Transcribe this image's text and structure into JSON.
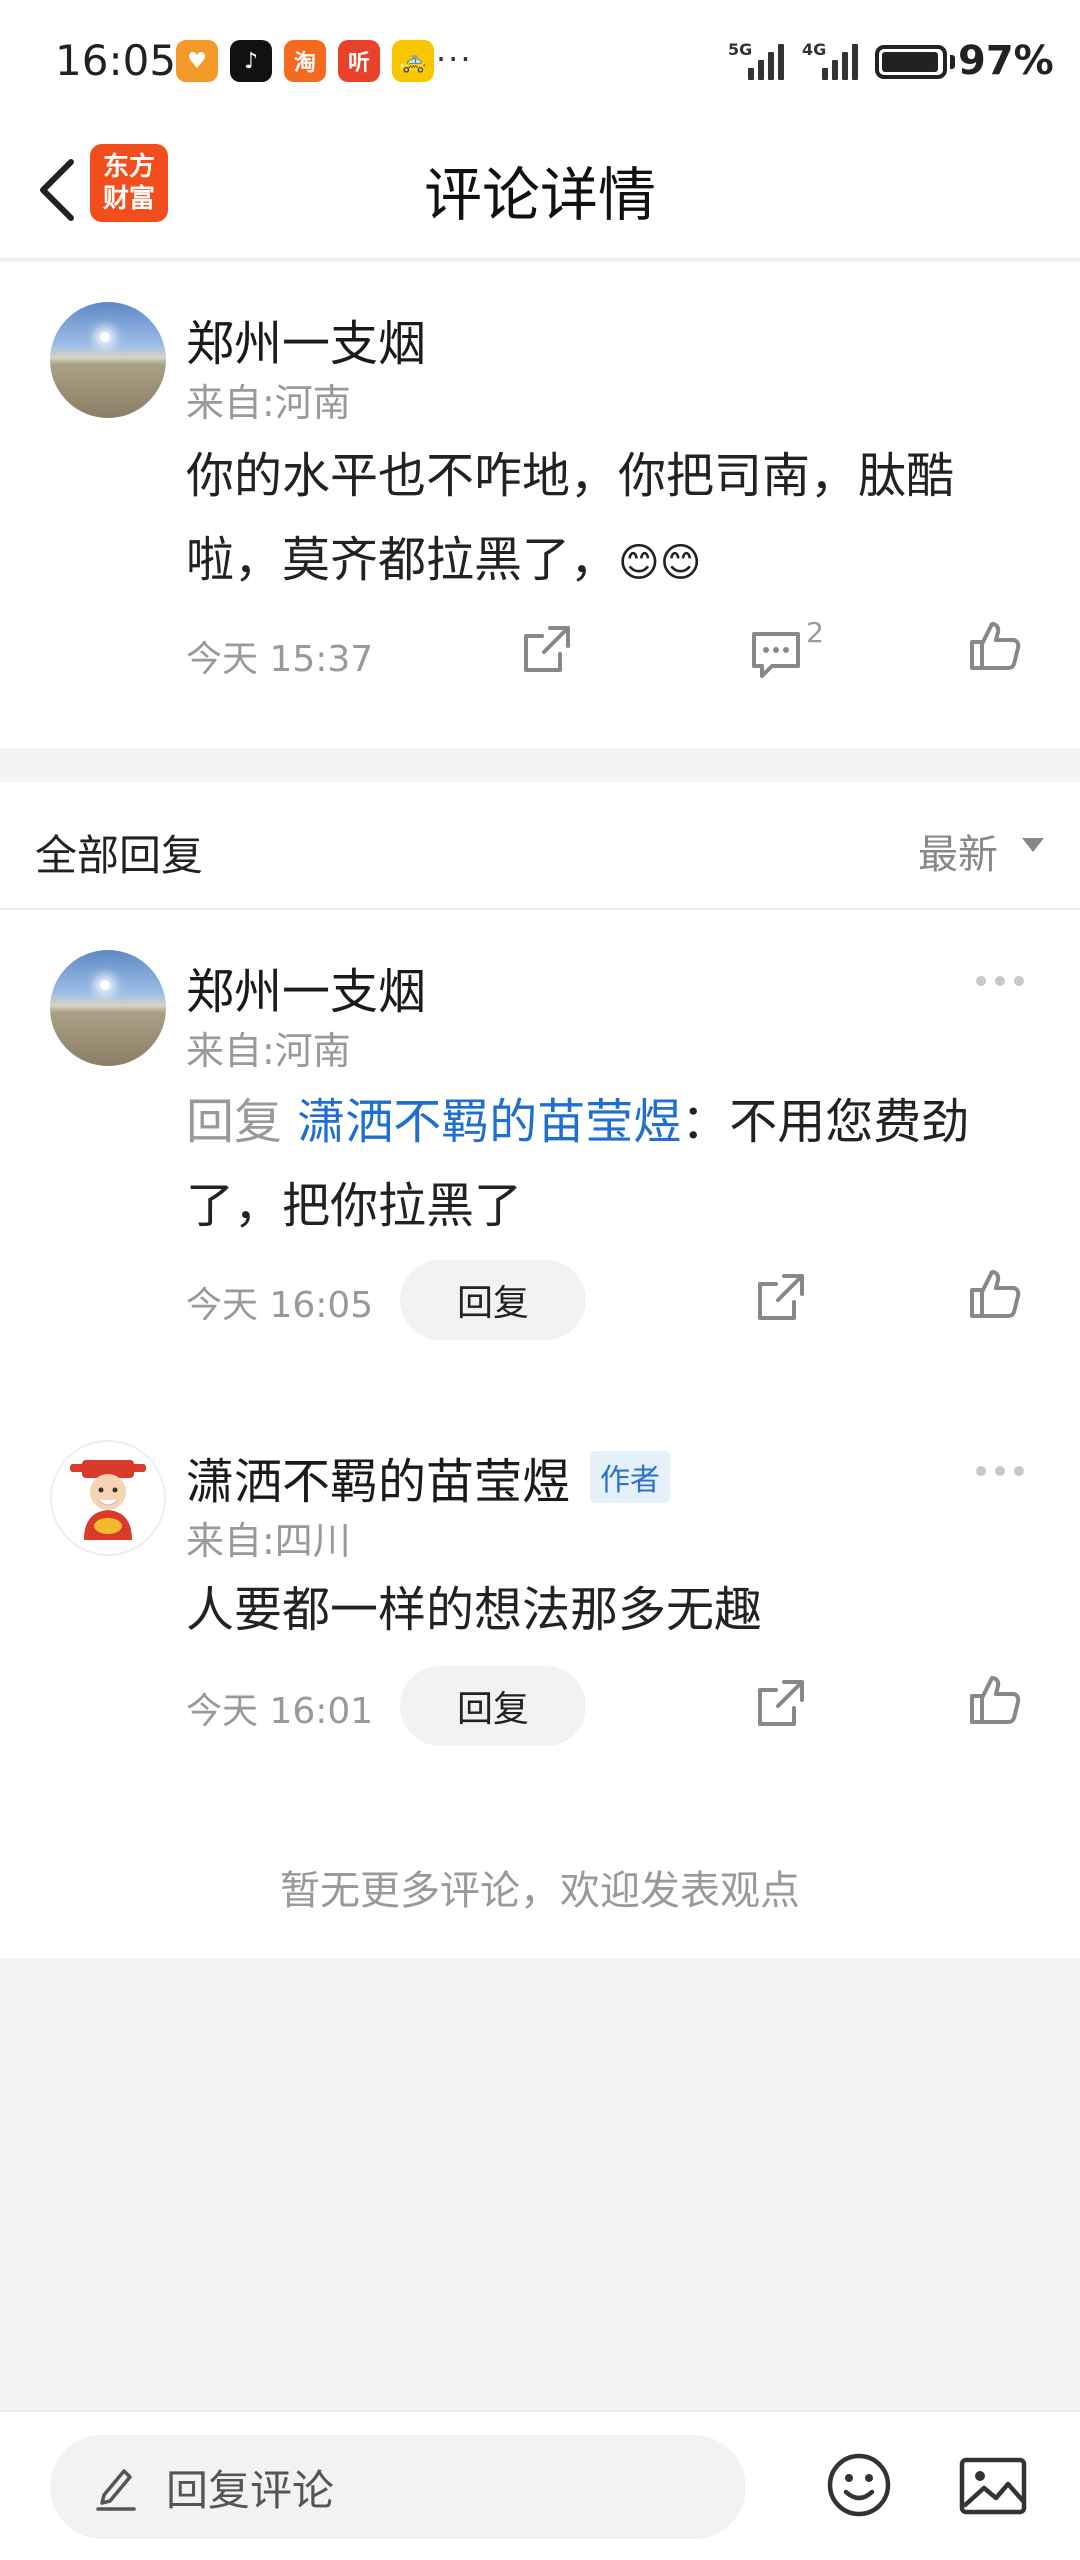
{
  "status_bar": {
    "time": "16:05",
    "app_icons": [
      {
        "name": "heart-app-icon",
        "glyph": "♥",
        "color": "#f39a2b"
      },
      {
        "name": "tiktok-app-icon",
        "glyph": "♪",
        "color": "#111111"
      },
      {
        "name": "taobao-app-icon",
        "glyph": "淘",
        "color": "#f56a1e"
      },
      {
        "name": "listen-app-icon",
        "glyph": "听",
        "color": "#e8422b"
      },
      {
        "name": "taxi-app-icon",
        "glyph": "🚕",
        "color": "#f7c600"
      }
    ],
    "more": "···",
    "signal_1_label": "5G",
    "signal_2_label": "4G",
    "battery_level": 0.97,
    "battery": "97%"
  },
  "header": {
    "back_icon": "chevron-left-icon",
    "brand_logo": "东方财富",
    "title": "评论详情"
  },
  "main_comment": {
    "name": "郑州一支烟",
    "origin": "来自:河南",
    "text": "你的水平也不咋地，你把司南，肽酷啦，莫齐都拉黑了，",
    "emoji": "😊😊",
    "time": "今天 15:37",
    "comment_count": "2"
  },
  "replies_section": {
    "title": "全部回复",
    "sort_label": "最新",
    "replies": [
      {
        "name": "郑州一支烟",
        "origin": "来自:河南",
        "prefix": "回复 ",
        "target": "潇洒不羁的苗莹煜",
        "text": "：不用您费劲了，把你拉黑了",
        "time": "今天 16:05",
        "reply_label": "回复"
      },
      {
        "name": "潇洒不羁的苗莹煜",
        "badge": "作者",
        "origin": "来自:四川",
        "text": "人要都一样的想法那多无趣",
        "time": "今天 16:01",
        "reply_label": "回复"
      }
    ],
    "no_more": "暂无更多评论，欢迎发表观点"
  },
  "bottom_bar": {
    "reply_placeholder": "回复评论",
    "pen_icon": "pencil-icon",
    "emoji_icon": "smiley-icon",
    "image_icon": "image-icon"
  }
}
